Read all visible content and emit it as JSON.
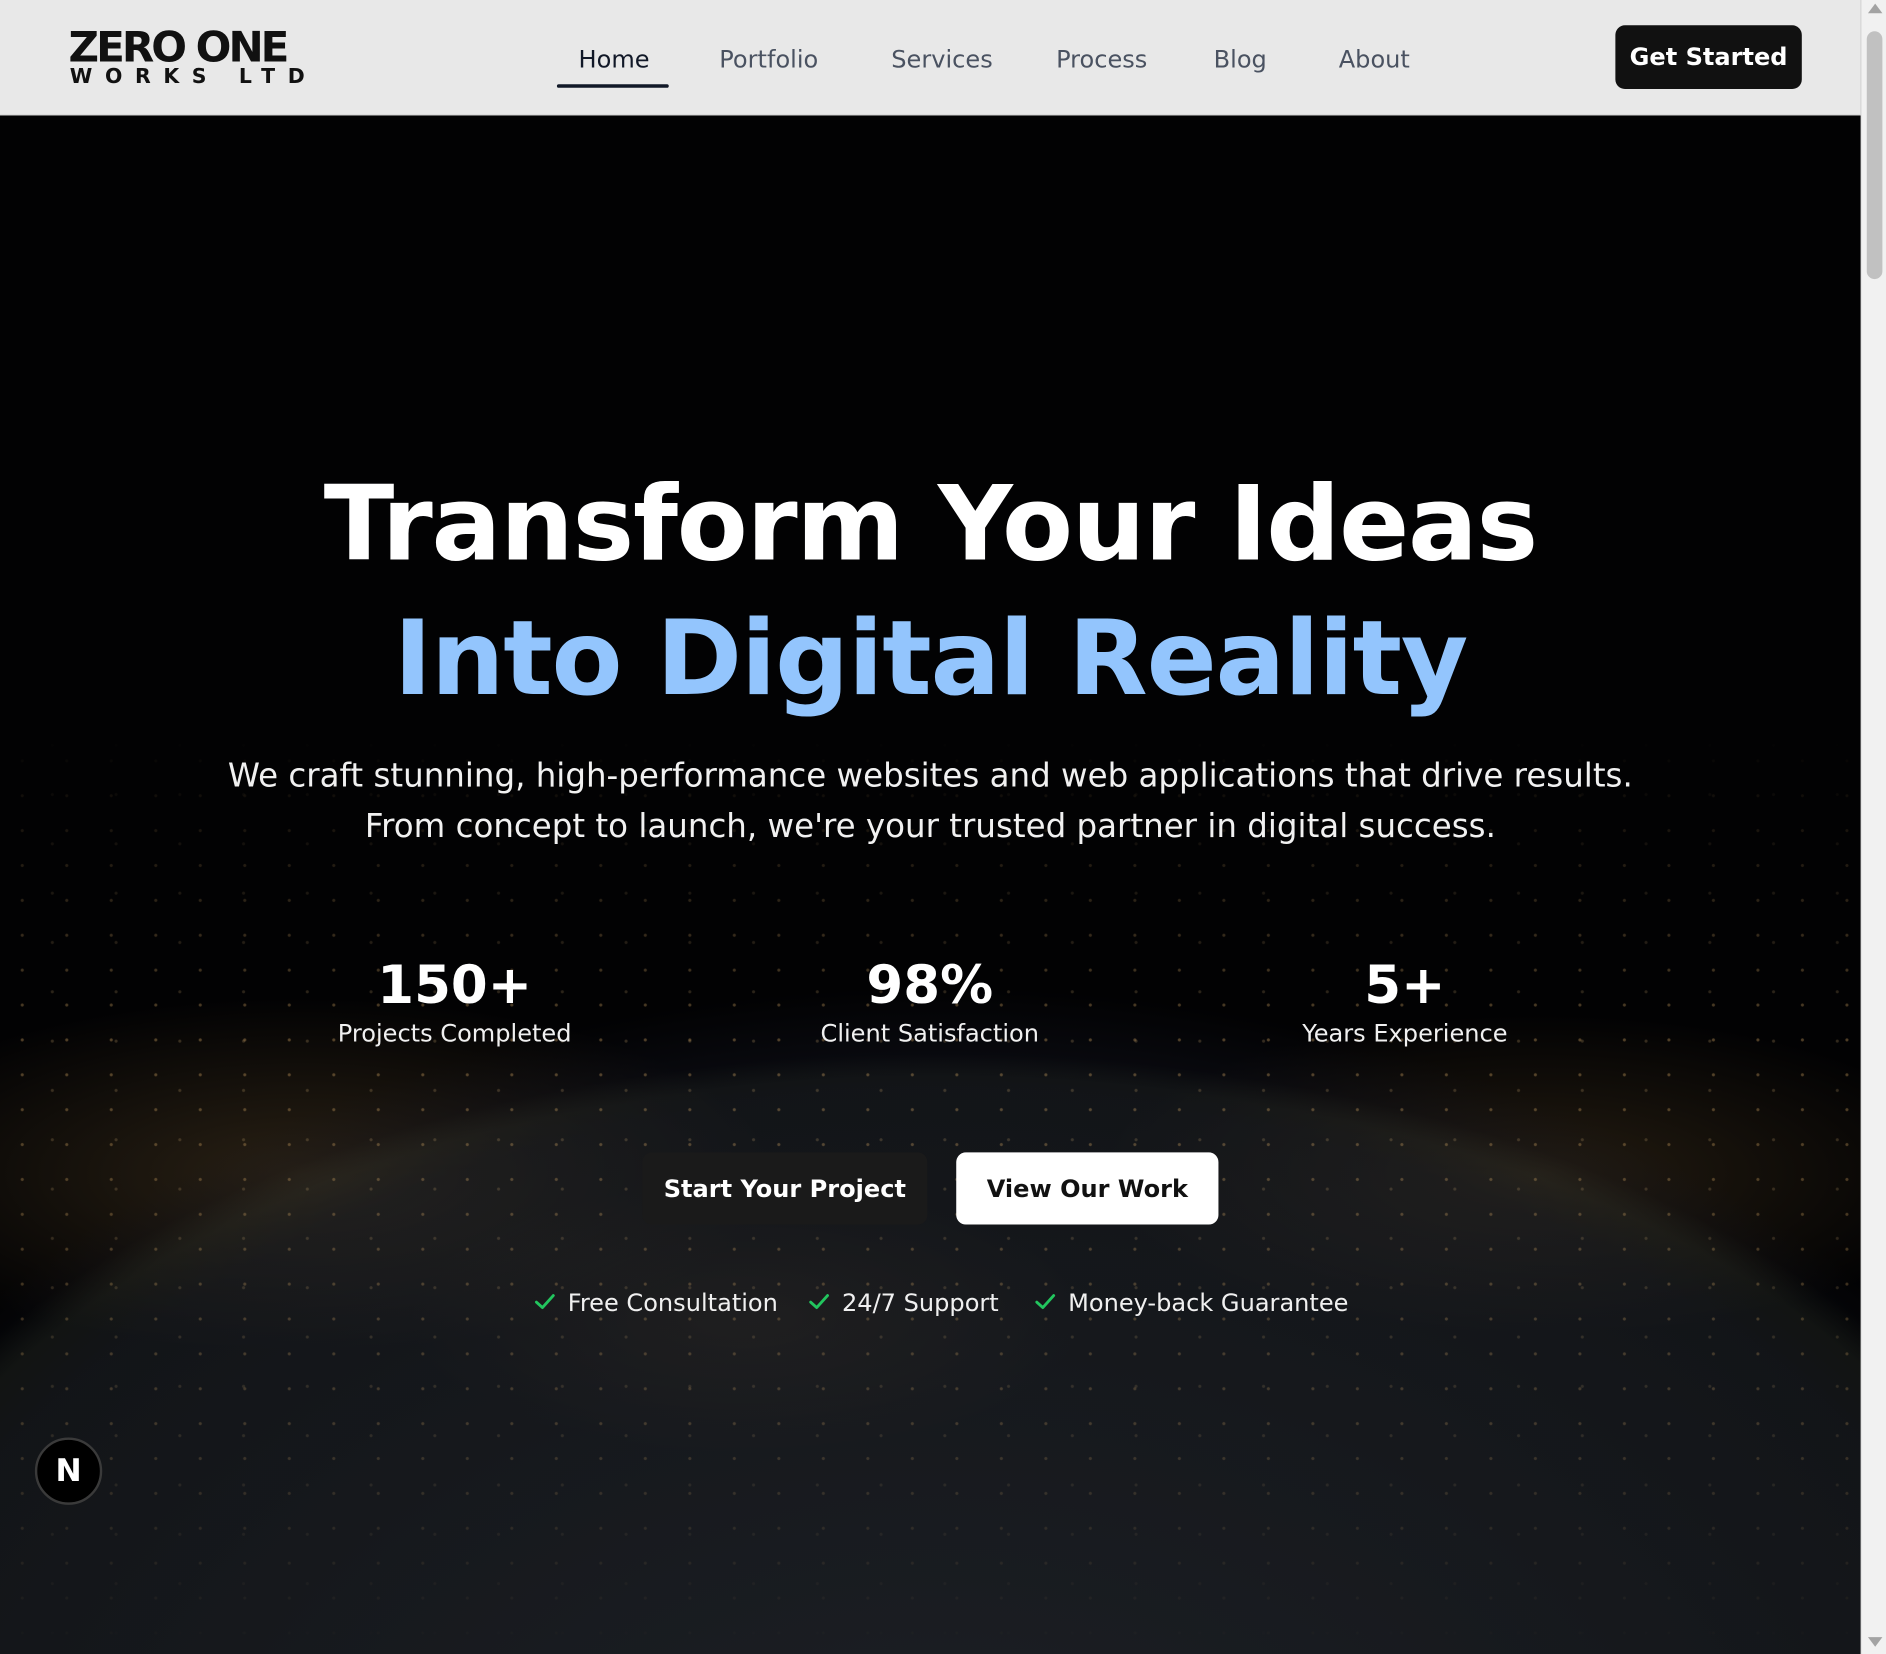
{
  "header": {
    "logo": {
      "line1": "ZERO ONE",
      "line2": "WORKS LTD"
    },
    "nav": [
      {
        "label": "Home",
        "active": true
      },
      {
        "label": "Portfolio",
        "active": false
      },
      {
        "label": "Services",
        "active": false
      },
      {
        "label": "Process",
        "active": false
      },
      {
        "label": "Blog",
        "active": false
      },
      {
        "label": "About",
        "active": false
      }
    ],
    "cta_label": "Get Started"
  },
  "hero": {
    "headline_line1": "Transform Your Ideas",
    "headline_line2": "Into Digital Reality",
    "subtitle_line1": "We craft stunning, high-performance websites and web applications that drive results.",
    "subtitle_line2": "From concept to launch, we're your trusted partner in digital success.",
    "stats": [
      {
        "value": "150+",
        "label": "Projects Completed"
      },
      {
        "value": "98%",
        "label": "Client Satisfaction"
      },
      {
        "value": "5+",
        "label": "Years Experience"
      }
    ],
    "primary_button": "Start Your Project",
    "secondary_button": "View Our Work",
    "features": [
      {
        "label": "Free Consultation",
        "icon": "check-icon"
      },
      {
        "label": "24/7 Support",
        "icon": "check-icon"
      },
      {
        "label": "Money-back Guarantee",
        "icon": "check-icon"
      }
    ]
  },
  "badge": {
    "letter": "N"
  },
  "colors": {
    "accent_blue": "#93c5fd",
    "check_green": "#22c55e",
    "header_bg": "#e8e8e8",
    "dark_button": "#111111"
  }
}
